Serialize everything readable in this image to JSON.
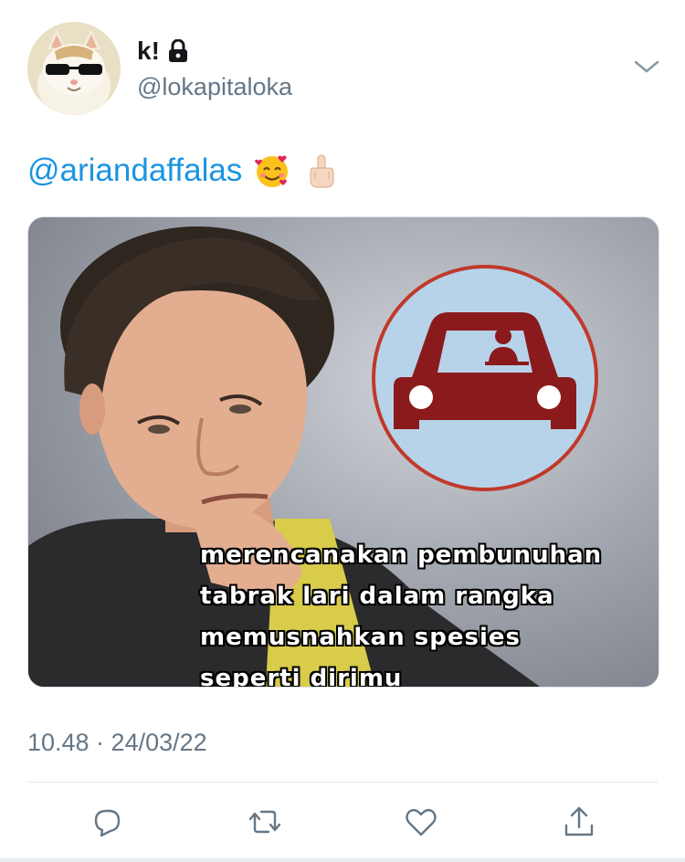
{
  "tweet": {
    "author": {
      "display_name": "k!",
      "handle": "@lokapitaloka",
      "avatar": "cat-with-sunglasses-avatar",
      "protected_icon": "lock-icon"
    },
    "menu_icon": "chevron-down-icon",
    "text": {
      "mention": "@ariandaffalas",
      "emojis": [
        "smiling-face-with-hearts-emoji",
        "middle-finger-emoji"
      ]
    },
    "media": {
      "description_icon": "car-in-circle-icon",
      "caption_lines": [
        "merencanakan pembunuhan",
        "tabrak lari dalam rangka",
        "memusnahkan spesies",
        "seperti dirimu"
      ]
    },
    "timestamp": "10.48 · 24/03/22",
    "actions": [
      {
        "name": "reply",
        "icon": "reply-icon"
      },
      {
        "name": "retweet",
        "icon": "retweet-icon"
      },
      {
        "name": "like",
        "icon": "heart-icon"
      },
      {
        "name": "share",
        "icon": "share-icon"
      }
    ],
    "colors": {
      "link": "#1b95e0",
      "secondary_text": "#657786",
      "icon_gray": "#657786",
      "car_red": "#8b1a1c",
      "circle_fill": "#b7d3ea",
      "circle_stroke": "#c0392b"
    }
  }
}
